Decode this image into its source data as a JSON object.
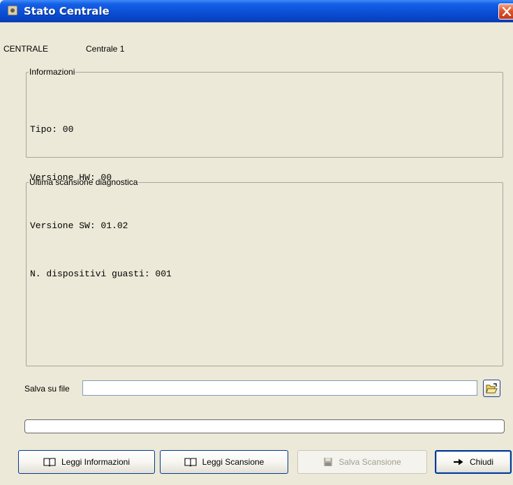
{
  "window": {
    "title": "Stato Centrale",
    "close_label": "Chiudi finestra"
  },
  "header": {
    "label": "CENTRALE",
    "value": "Centrale 1"
  },
  "info": {
    "legend": "Informazioni",
    "lines": [
      "Tipo: 00",
      "Versione HW: 00",
      "Versione SW: 01.02",
      "N. dispositivi guasti: 001"
    ]
  },
  "scan": {
    "legend": "Ultima scansione diagnostica"
  },
  "save": {
    "label": "Salva su file",
    "value": ""
  },
  "progress": {
    "value": 0
  },
  "buttons": {
    "read_info": "Leggi Informazioni",
    "read_scan": "Leggi Scansione",
    "save_scan": "Salva Scansione",
    "close": "Chiudi"
  },
  "icons": {
    "app": "app-icon",
    "close": "close-icon",
    "folder": "open-folder-icon",
    "book": "book-icon",
    "save": "floppy-disk-icon",
    "arrow": "arrow-right-icon"
  },
  "colors": {
    "titlebar": "#0a4fd6",
    "window_bg": "#ece9d8",
    "close": "#e0542d"
  }
}
